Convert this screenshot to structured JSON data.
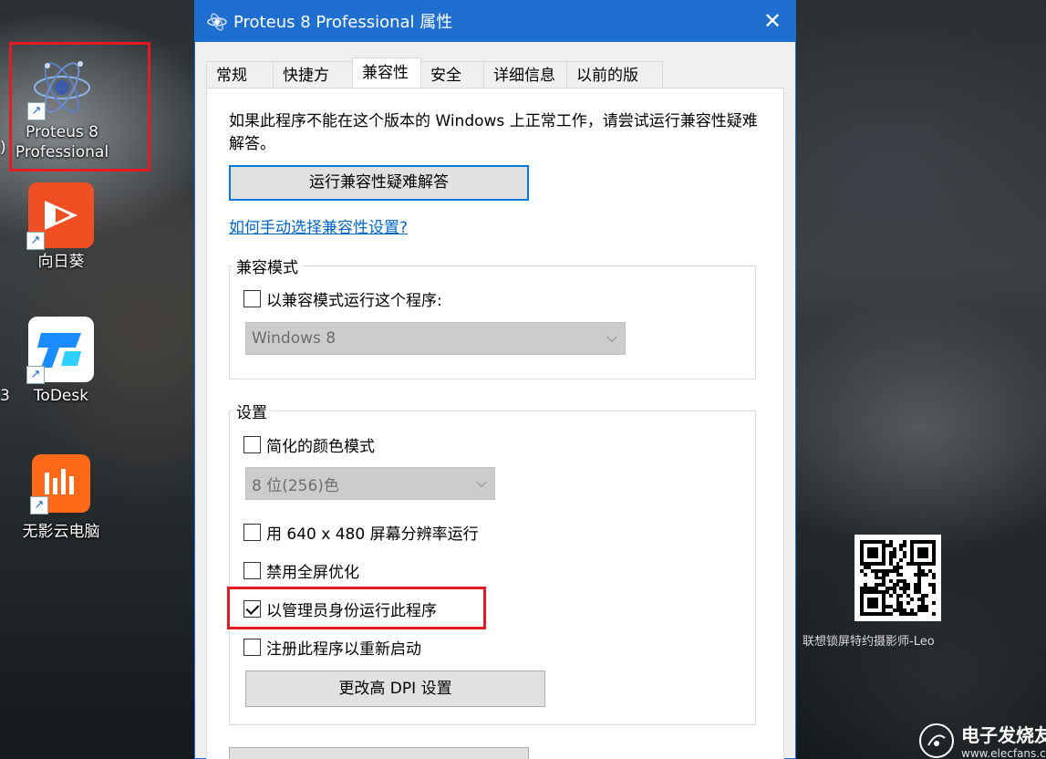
{
  "desktop": {
    "icons": [
      {
        "label_line1": "Proteus 8",
        "label_line2": "Professional"
      },
      {
        "label": "向日葵"
      },
      {
        "label": "ToDesk"
      },
      {
        "label": "无影云电脑"
      }
    ],
    "edge_fragments": [
      ")",
      "3"
    ]
  },
  "dialog": {
    "title": "Proteus 8 Professional 属性",
    "close_label": "✕",
    "tabs": [
      "常规",
      "快捷方式",
      "兼容性",
      "安全",
      "详细信息",
      "以前的版本"
    ],
    "active_tab": "兼容性",
    "intro_text": "如果此程序不能在这个版本的 Windows 上正常工作，请尝试运行兼容性疑难解答。",
    "troubleshoot_button": "运行兼容性疑难解答",
    "manual_link": "如何手动选择兼容性设置?",
    "compat_mode": {
      "title": "兼容模式",
      "checkbox_label": "以兼容模式运行这个程序:",
      "checked": false,
      "select_value": "Windows 8"
    },
    "settings": {
      "title": "设置",
      "reduced_color": {
        "label": "简化的颜色模式",
        "checked": false
      },
      "color_select_value": "8 位(256)色",
      "res_640": {
        "label": "用 640 x 480 屏幕分辨率运行",
        "checked": false
      },
      "disable_fullscreen": {
        "label": "禁用全屏优化",
        "checked": false
      },
      "run_as_admin": {
        "label": "以管理员身份运行此程序",
        "checked": true
      },
      "register_restart": {
        "label": "注册此程序以重新启动",
        "checked": false
      },
      "dpi_button": "更改高 DPI 设置"
    }
  },
  "watermark": {
    "qr_caption": "联想锁屏特约摄影师-Leo",
    "brand_name": "电子发烧友",
    "brand_url": "www.elecfans.com"
  }
}
